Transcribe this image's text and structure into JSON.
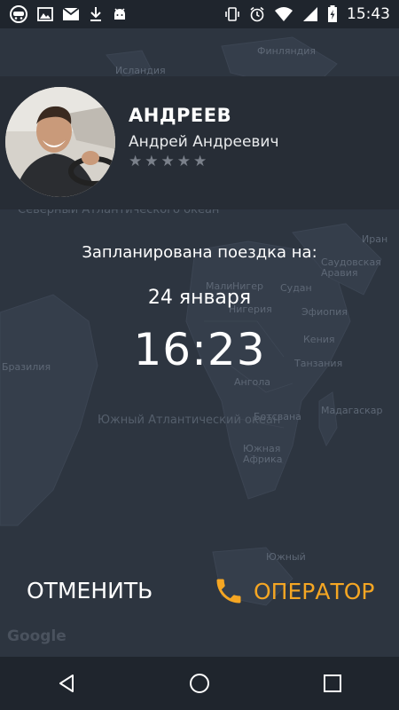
{
  "status_bar": {
    "time": "15:43",
    "left_icons": [
      "android-head-icon",
      "image-icon",
      "mail-icon",
      "download-icon",
      "android-robot-icon"
    ],
    "right_icons": [
      "vibrate-icon",
      "alarm-icon",
      "wifi-icon",
      "signal-icon",
      "battery-charging-icon"
    ]
  },
  "map": {
    "labels": [
      "Исландия",
      "Финляндия",
      "Северный Атлантического океан",
      "Иран",
      "Саудовская Аравия",
      "Мали",
      "Нигер",
      "Судан",
      "Нигерия",
      "Эфиопия",
      "Кения",
      "Бразилия",
      "Танзания",
      "Ангола",
      "Южный Атлантический океан",
      "Ботсвана",
      "Мадагаскар",
      "Южная Африка",
      "Южный"
    ],
    "attribution": "Google"
  },
  "driver": {
    "surname": "АНДРЕЕВ",
    "full_name": "Андрей Андреевич",
    "rating": 0,
    "rating_max": 5
  },
  "trip": {
    "planned_label": "Запланирована поездка на:",
    "date": "24 января",
    "time": "16:23"
  },
  "actions": {
    "cancel_label": "ОТМЕНИТЬ",
    "operator_label": "ОПЕРАТОР",
    "operator_icon": "phone-icon"
  },
  "nav": {
    "icons": [
      "back-icon",
      "home-icon",
      "recents-icon"
    ]
  },
  "colors": {
    "accent": "#f5a623",
    "background": "#2a313c",
    "card": "#272d36",
    "bar": "#1f252d"
  }
}
